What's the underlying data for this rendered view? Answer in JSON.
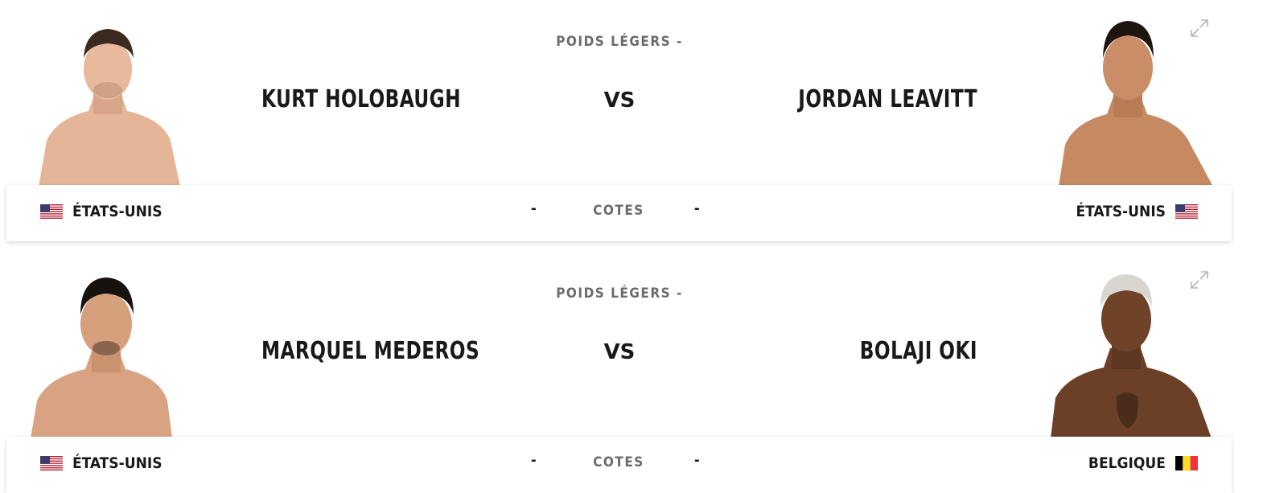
{
  "bouts": [
    {
      "weight_class": "POIDS LÉGERS -",
      "red_corner": {
        "name": "KURT HOLOBAUGH",
        "country": "ÉTATS-UNIS",
        "flag": "usa-flag-icon"
      },
      "vs": "VS",
      "blue_corner": {
        "name": "JORDAN LEAVITT",
        "country": "ÉTATS-UNIS",
        "flag": "usa-flag-icon"
      },
      "odds": {
        "label": "COTES",
        "red": "-",
        "blue": "-"
      }
    },
    {
      "weight_class": "POIDS LÉGERS -",
      "red_corner": {
        "name": "MARQUEL MEDEROS",
        "country": "ÉTATS-UNIS",
        "flag": "usa-flag-icon"
      },
      "vs": "VS",
      "blue_corner": {
        "name": "BOLAJI OKI",
        "country": "BELGIQUE",
        "flag": "belgium-flag-icon"
      },
      "odds": {
        "label": "COTES",
        "red": "-",
        "blue": "-"
      }
    }
  ],
  "colors": {
    "text": "#191919",
    "muted": "#6b6b6b",
    "skin_light": "#e7b89a",
    "skin_mid": "#c98e6a",
    "skin_dark": "#6b4027"
  }
}
